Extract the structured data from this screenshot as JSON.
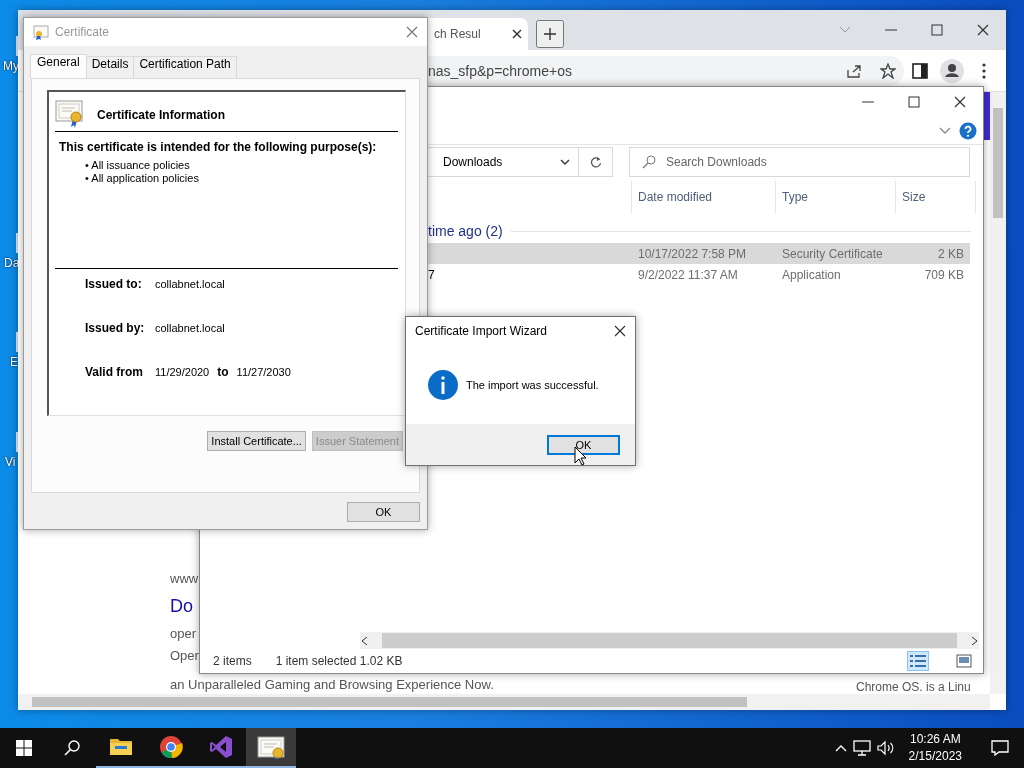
{
  "desktop": {
    "icon_labels": [
      "My",
      "Da",
      "E",
      "Vi"
    ]
  },
  "browser": {
    "tabs": [
      {
        "title": "ch Resul",
        "selected": true
      }
    ],
    "address": "nas_sfp&p=chrome+os",
    "page_texts": [
      {
        "text": "www",
        "kind": "plain"
      },
      {
        "text": "Do",
        "kind": "link"
      },
      {
        "text": "oper",
        "kind": "plain"
      },
      {
        "text": "Oper",
        "kind": "plain"
      },
      {
        "text": "an Unparalleled Gaming and Browsing Experience Now.",
        "kind": "plain"
      }
    ],
    "edge_texts": [
      "Chrome OS. is a Linu"
    ]
  },
  "explorer": {
    "location": "Downloads",
    "search": {
      "placeholder": "Search Downloads"
    },
    "columns": [
      "Date modified",
      "Type",
      "Size"
    ],
    "group": "time ago (2)",
    "rows": [
      {
        "date": "10/17/2022 7:58 PM",
        "type": "Security Certificate",
        "size": "2 KB",
        "selected": true
      },
      {
        "name": "7",
        "date": "9/2/2022 11:37 AM",
        "type": "Application",
        "size": "709 KB",
        "selected": false
      }
    ],
    "status": {
      "count": "2 items",
      "selection": "1 item selected  1.02 KB"
    }
  },
  "certificate_dialog": {
    "title": "Certificate",
    "tabs": [
      {
        "label": "General",
        "selected": true
      },
      {
        "label": "Details",
        "selected": false
      },
      {
        "label": "Certification Path",
        "selected": false
      }
    ],
    "heading": "Certificate Information",
    "purpose_title": "This certificate is intended for the following purpose(s):",
    "purposes": [
      "• All issuance policies",
      "• All application policies"
    ],
    "issued_to": {
      "label": "Issued to:",
      "value": "collabnet.local"
    },
    "issued_by": {
      "label": "Issued by:",
      "value": "collabnet.local"
    },
    "valid": {
      "label": "Valid from",
      "from": "11/29/2020",
      "to_label": "to",
      "to": "11/27/2030"
    },
    "buttons": [
      {
        "label": "Install Certificate...",
        "disabled": false
      },
      {
        "label": "Issuer Statement",
        "disabled": true
      }
    ],
    "ok": "OK"
  },
  "import_wizard": {
    "title": "Certificate Import Wizard",
    "message": "The import was successful.",
    "ok": "OK"
  },
  "taskbar": {
    "apps": [
      {
        "kind": "folder",
        "active": false
      },
      {
        "kind": "browser",
        "active": false
      },
      {
        "kind": "studio",
        "active": false
      },
      {
        "kind": "certificate",
        "active": true
      }
    ],
    "time": "10:26 AM",
    "date": "2/15/2023"
  }
}
